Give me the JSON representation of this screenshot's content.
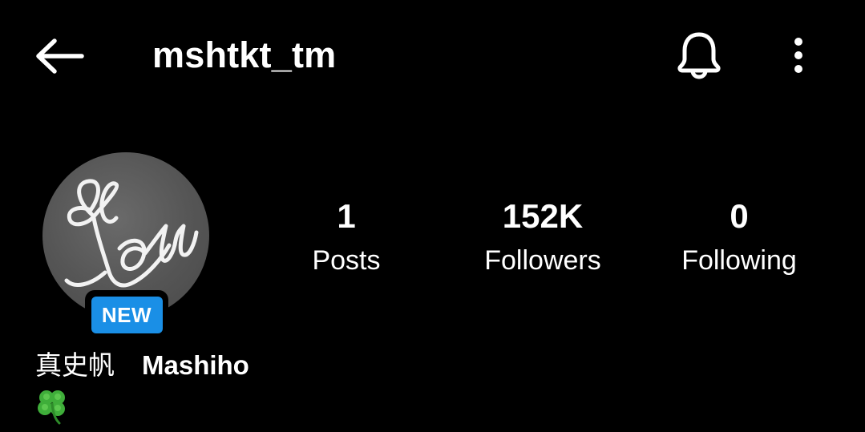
{
  "header": {
    "username": "mshtkt_tm",
    "back_icon": "arrow-left-icon",
    "notification_icon": "bell-icon",
    "more_icon": "vertical-dots-icon"
  },
  "profile": {
    "badge_label": "NEW",
    "badge_color": "#1a8fe6",
    "name_jp": "真史帆",
    "name_en": "Mashiho",
    "bio_icon": "four-leaf-clover-icon"
  },
  "stats": [
    {
      "value": "1",
      "label": "Posts"
    },
    {
      "value": "152K",
      "label": "Followers"
    },
    {
      "value": "0",
      "label": "Following"
    }
  ]
}
